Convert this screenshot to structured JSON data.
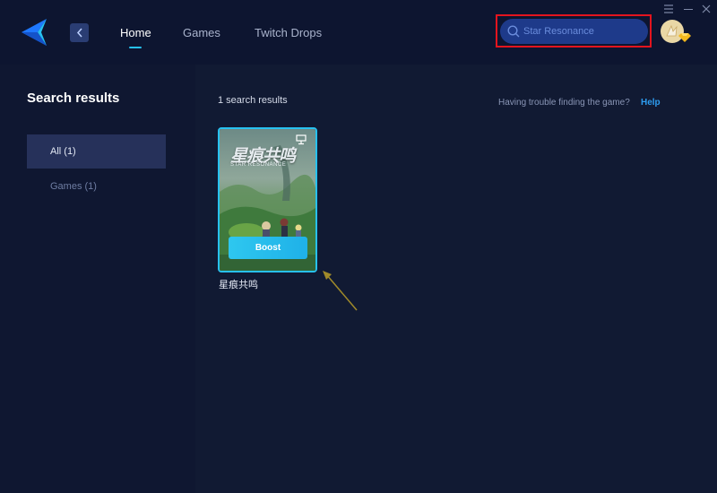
{
  "header": {
    "tabs": [
      {
        "label": "Home",
        "active": true
      },
      {
        "label": "Games",
        "active": false
      },
      {
        "label": "Twitch Drops",
        "active": false
      }
    ],
    "search": {
      "value": "Star Resonance",
      "placeholder": "Star Resonance"
    },
    "icons": {
      "logo": "logo-icon",
      "back": "chevron-left-icon",
      "menu": "menu-icon",
      "minimize": "minimize-icon",
      "close": "close-icon",
      "avatar": "avatar",
      "vip_badge": "diamond-badge-icon"
    }
  },
  "sidebar": {
    "title": "Search results",
    "items": [
      {
        "label": "All (1)",
        "selected": true
      },
      {
        "label": "Games (1)",
        "selected": false
      }
    ]
  },
  "main": {
    "results_count": "1 search results",
    "trouble_text": "Having trouble finding the game?",
    "help_link": "Help",
    "games": [
      {
        "name": "星痕共鸣",
        "art_title": "星痕共鸣",
        "art_subtitle": "STAR RESONANCE",
        "boost_label": "Boost"
      }
    ]
  },
  "colors": {
    "accent": "#27c1f0",
    "highlight_box": "#e3141e",
    "background": "#111a33"
  }
}
